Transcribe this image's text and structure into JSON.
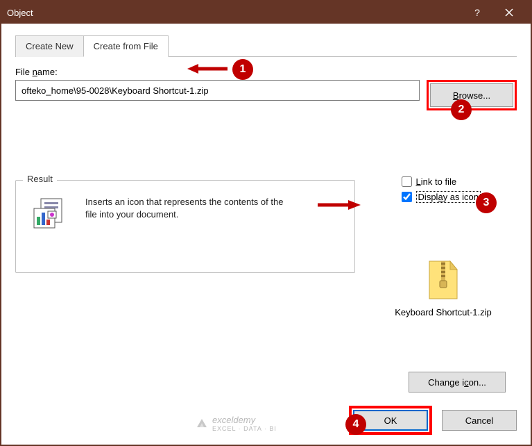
{
  "title": "Object",
  "tabs": {
    "create_new": "Create New",
    "create_from_file": "Create from File"
  },
  "file": {
    "label": "File name:",
    "value": "ofteko_home\\95-0028\\Keyboard Shortcut-1.zip",
    "browse": "Browse..."
  },
  "options": {
    "link": "Link to file",
    "display_icon": "Display as icon"
  },
  "result": {
    "legend": "Result",
    "text": "Inserts an icon that represents the contents of the file into your document."
  },
  "preview": {
    "filename": "Keyboard Shortcut-1.zip"
  },
  "buttons": {
    "change_icon": "Change icon...",
    "ok": "OK",
    "cancel": "Cancel"
  },
  "badges": {
    "b1": "1",
    "b2": "2",
    "b3": "3",
    "b4": "4"
  },
  "watermark": {
    "main": "exceldemy",
    "sub": "EXCEL · DATA · BI"
  }
}
